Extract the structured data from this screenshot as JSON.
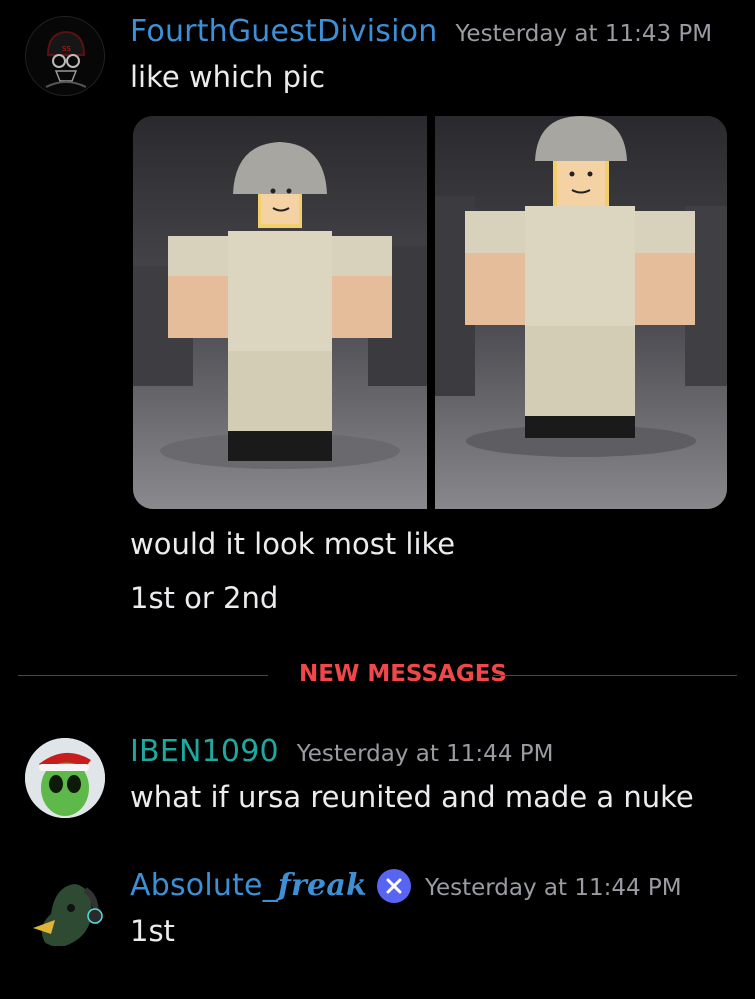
{
  "messages": [
    {
      "author": "FourthGuestDivision",
      "author_color": "#3d8fd6",
      "timestamp": "Yesterday at 11:43 PM",
      "lines": [
        "like which pic",
        "would it look most like",
        "1st or 2nd"
      ],
      "attachments": [
        {
          "icon": "roblox-soldier-image-1"
        },
        {
          "icon": "roblox-soldier-image-2"
        }
      ]
    },
    {
      "author": "IBEN1090",
      "author_color": "#1fa8a0",
      "timestamp": "Yesterday at 11:44 PM",
      "lines": [
        "what if ursa reunited and made a nuke"
      ]
    },
    {
      "author_prefix": "Absolute_",
      "author_styled": "freak",
      "author_color": "#3d8fd6",
      "badge_icon": "crossed-tools-badge-icon",
      "timestamp": "Yesterday at 11:44 PM",
      "lines": [
        "1st"
      ]
    }
  ],
  "divider": {
    "label": "NEW MESSAGES",
    "color": "#f0474a"
  }
}
